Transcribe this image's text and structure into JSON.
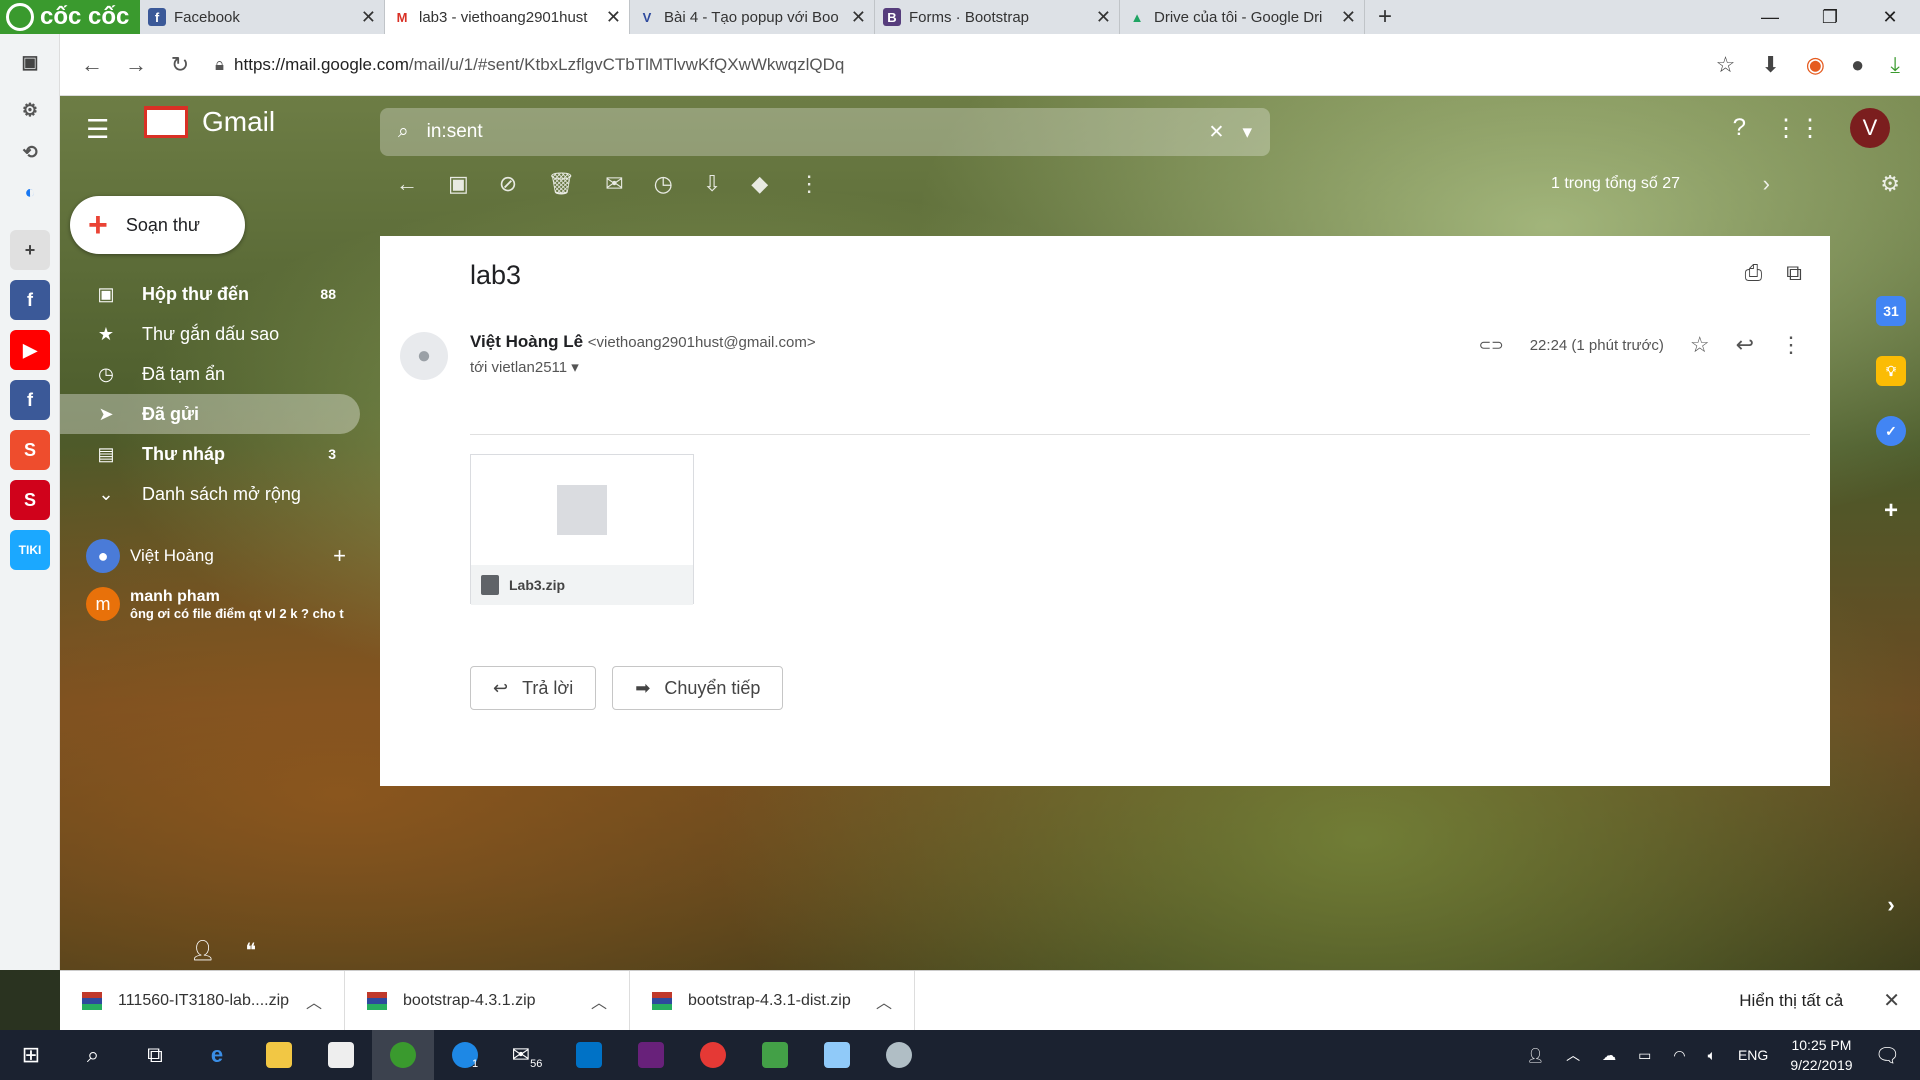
{
  "browser": {
    "brand": "cốc cốc",
    "tabs": [
      {
        "title": "Facebook",
        "fav_color": "#3b5998",
        "fav_letter": "f"
      },
      {
        "title": "lab3 - viethoang2901hust",
        "fav_color": "#d93025",
        "fav_letter": "M"
      },
      {
        "title": "Bài 4 - Tạo popup với Boo",
        "fav_color": "#ffffff",
        "fav_letter": "V"
      },
      {
        "title": "Forms · Bootstrap",
        "fav_color": "#563d7c",
        "fav_letter": "B"
      },
      {
        "title": "Drive của tôi - Google Dri",
        "fav_color": "#1fa463",
        "fav_letter": "▲"
      }
    ],
    "url_host": "https://mail.google.com",
    "url_path": "/mail/u/1/#sent/KtbxLzflgvCTbTlMTlvwKfQXwWkwqzlQDq"
  },
  "gmail": {
    "product": "Gmail",
    "search_value": "in:sent",
    "compose": "Soạn thư",
    "avatar_letter": "V",
    "nav": [
      {
        "label": "Hộp thư đến",
        "count": "88",
        "icon": "inbox-icon",
        "glyph": "▣",
        "bold": true
      },
      {
        "label": "Thư gắn dấu sao",
        "count": "",
        "icon": "star-icon",
        "glyph": "★",
        "bold": false
      },
      {
        "label": "Đã tạm ẩn",
        "count": "",
        "icon": "clock-icon",
        "glyph": "◷",
        "bold": false
      },
      {
        "label": "Đã gửi",
        "count": "",
        "icon": "send-icon",
        "glyph": "➤",
        "bold": true,
        "active": true
      },
      {
        "label": "Thư nháp",
        "count": "3",
        "icon": "draft-icon",
        "glyph": "▤",
        "bold": true
      },
      {
        "label": "Danh sách mở rộng",
        "count": "",
        "icon": "chevron-down-icon",
        "glyph": "⌄",
        "bold": false
      }
    ],
    "hangouts": {
      "me": "Việt Hoàng",
      "chat_name": "manh pham",
      "chat_letter": "m",
      "chat_preview": "ông ơi có file điểm qt vl 2 k ? cho t"
    },
    "pager": "1 trong tổng số 27",
    "mail": {
      "subject": "lab3",
      "sender_name": "Việt Hoàng Lê",
      "sender_email": "<viethoang2901hust@gmail.com>",
      "to": "tới vietlan2511",
      "time": "22:24 (1 phút trước)",
      "attachment": "Lab3.zip",
      "reply": "Trả lời",
      "forward": "Chuyển tiếp"
    }
  },
  "downloads": {
    "items": [
      "111560-IT3180-lab....zip",
      "bootstrap-4.3.1.zip",
      "bootstrap-4.3.1-dist.zip"
    ],
    "show_all": "Hiển thị tất cả"
  },
  "taskbar": {
    "lang": "ENG",
    "time": "10:25 PM",
    "date": "9/22/2019",
    "badge_1": "1",
    "badge_56": "56"
  }
}
